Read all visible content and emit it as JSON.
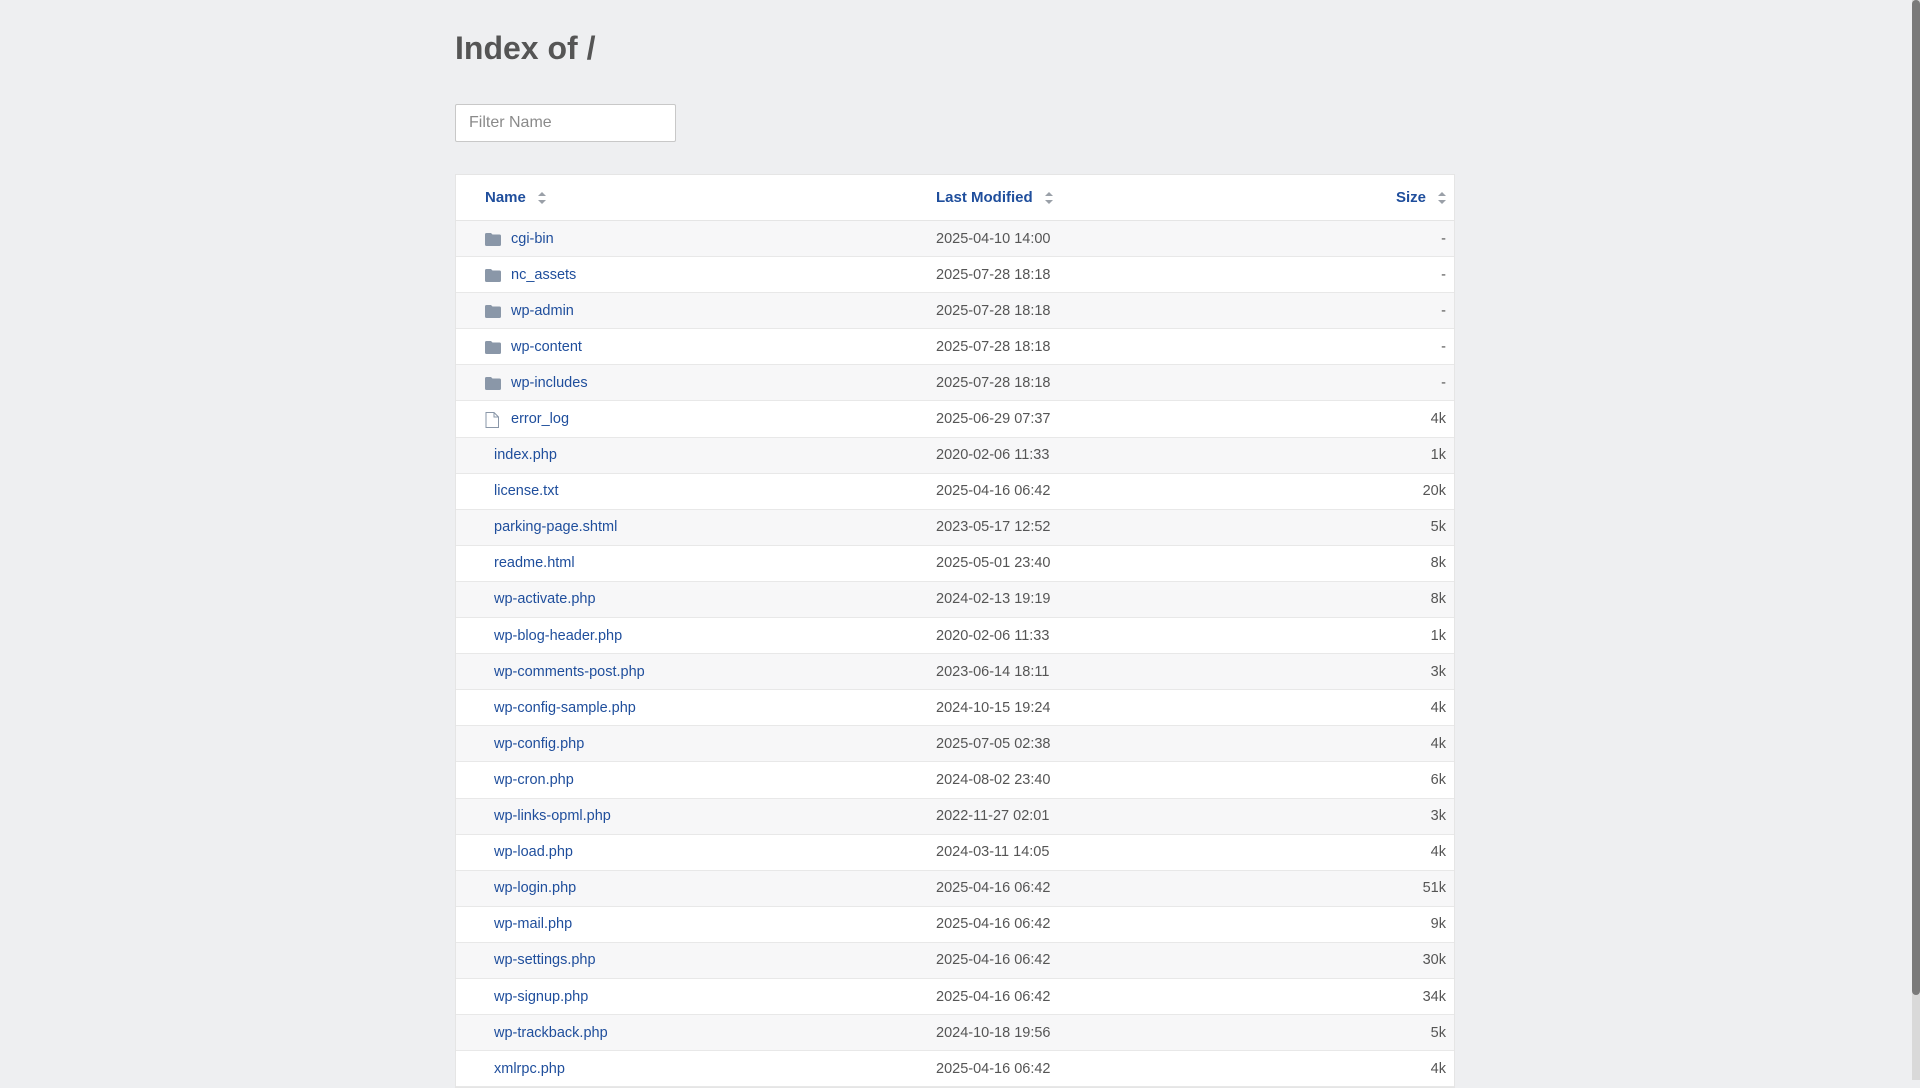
{
  "page": {
    "title": "Index of /"
  },
  "filter": {
    "placeholder": "Filter Name"
  },
  "columns": {
    "name": "Name",
    "modified": "Last Modified",
    "size": "Size"
  },
  "rows": [
    {
      "name": "cgi-bin",
      "modified": "2025-04-10 14:00",
      "size": "-",
      "type": "folder"
    },
    {
      "name": "nc_assets",
      "modified": "2025-07-28 18:18",
      "size": "-",
      "type": "folder"
    },
    {
      "name": "wp-admin",
      "modified": "2025-07-28 18:18",
      "size": "-",
      "type": "folder"
    },
    {
      "name": "wp-content",
      "modified": "2025-07-28 18:18",
      "size": "-",
      "type": "folder"
    },
    {
      "name": "wp-includes",
      "modified": "2025-07-28 18:18",
      "size": "-",
      "type": "folder"
    },
    {
      "name": "error_log",
      "modified": "2025-06-29 07:37",
      "size": "4k",
      "type": "file"
    },
    {
      "name": "index.php",
      "modified": "2020-02-06 11:33",
      "size": "1k",
      "type": "none"
    },
    {
      "name": "license.txt",
      "modified": "2025-04-16 06:42",
      "size": "20k",
      "type": "none"
    },
    {
      "name": "parking-page.shtml",
      "modified": "2023-05-17 12:52",
      "size": "5k",
      "type": "none"
    },
    {
      "name": "readme.html",
      "modified": "2025-05-01 23:40",
      "size": "8k",
      "type": "none"
    },
    {
      "name": "wp-activate.php",
      "modified": "2024-02-13 19:19",
      "size": "8k",
      "type": "none"
    },
    {
      "name": "wp-blog-header.php",
      "modified": "2020-02-06 11:33",
      "size": "1k",
      "type": "none"
    },
    {
      "name": "wp-comments-post.php",
      "modified": "2023-06-14 18:11",
      "size": "3k",
      "type": "none"
    },
    {
      "name": "wp-config-sample.php",
      "modified": "2024-10-15 19:24",
      "size": "4k",
      "type": "none"
    },
    {
      "name": "wp-config.php",
      "modified": "2025-07-05 02:38",
      "size": "4k",
      "type": "none"
    },
    {
      "name": "wp-cron.php",
      "modified": "2024-08-02 23:40",
      "size": "6k",
      "type": "none"
    },
    {
      "name": "wp-links-opml.php",
      "modified": "2022-11-27 02:01",
      "size": "3k",
      "type": "none"
    },
    {
      "name": "wp-load.php",
      "modified": "2024-03-11 14:05",
      "size": "4k",
      "type": "none"
    },
    {
      "name": "wp-login.php",
      "modified": "2025-04-16 06:42",
      "size": "51k",
      "type": "none"
    },
    {
      "name": "wp-mail.php",
      "modified": "2025-04-16 06:42",
      "size": "9k",
      "type": "none"
    },
    {
      "name": "wp-settings.php",
      "modified": "2025-04-16 06:42",
      "size": "30k",
      "type": "none"
    },
    {
      "name": "wp-signup.php",
      "modified": "2025-04-16 06:42",
      "size": "34k",
      "type": "none"
    },
    {
      "name": "wp-trackback.php",
      "modified": "2024-10-18 19:56",
      "size": "5k",
      "type": "none"
    },
    {
      "name": "xmlrpc.php",
      "modified": "2025-04-16 06:42",
      "size": "4k",
      "type": "none"
    }
  ],
  "colors": {
    "link": "#1f4e9c",
    "background": "#eeeff1",
    "folder_icon": "#8a97a8"
  },
  "icons": {
    "folder": "folder-icon",
    "file": "file-icon",
    "sort": "sort-icon"
  }
}
